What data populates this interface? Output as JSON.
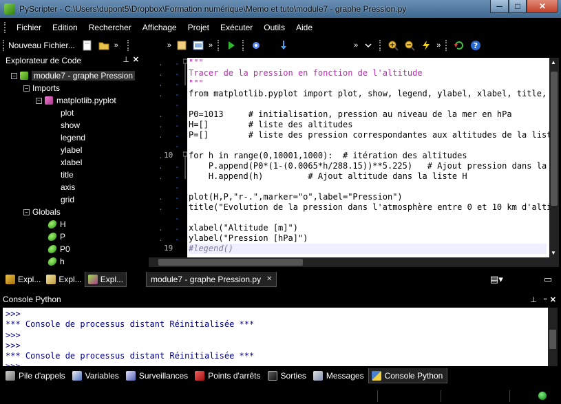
{
  "window": {
    "title": "PyScripter - C:\\Users\\dupont5\\Dropbox\\Formation numérique\\Memo et tuto\\module7 - graphe Pression.py",
    "min_label": "─",
    "max_label": "□",
    "close_label": "✕"
  },
  "menu": [
    "Fichier",
    "Edition",
    "Rechercher",
    "Affichage",
    "Projet",
    "Exécuter",
    "Outils",
    "Aide"
  ],
  "toolbar": {
    "new_file_label": "Nouveau Fichier...",
    "overflow_label": "»"
  },
  "explorer": {
    "title": "Explorateur de Code",
    "module": "module7 - graphe Pression",
    "imports_label": "Imports",
    "import_module": "matplotlib.pyplot",
    "imported_names": [
      "plot",
      "show",
      "legend",
      "ylabel",
      "xlabel",
      "title",
      "axis",
      "grid"
    ],
    "globals_label": "Globals",
    "globals": [
      "H",
      "P",
      "P0",
      "h"
    ],
    "tabs": [
      "Expl...",
      "Expl...",
      "Expl..."
    ]
  },
  "editor": {
    "tab_label": "module7 - graphe Pression.py",
    "tab_close": "✕",
    "line_numbers": [
      "10",
      "19"
    ],
    "code": [
      "\"\"\"",
      "Tracer de la pression en fonction de l'altitude",
      "\"\"\"",
      "from matplotlib.pyplot import plot, show, legend, ylabel, xlabel, title,",
      "",
      "P0=1013     # initialisation, pression au niveau de la mer en hPa",
      "H=[]        # liste des altitudes",
      "P=[]        # liste des pression correspondantes aux altitudes de la list",
      "",
      "for h in range(0,10001,1000):  # itération des altitudes",
      "    P.append(P0*(1-(0.0065*h/288.15))**5.225)   # Ajout pression dans la",
      "    H.append(h)         # Ajout altitude dans la liste H",
      "",
      "plot(H,P,\"r-.\",marker=\"o\",label=\"Pression\")",
      "title(\"Evolution de la pression dans l'atmosphère entre 0 et 10 km d'alti",
      "",
      "xlabel(\"Altitude [m]\")",
      "ylabel(\"Pression [hPa]\")",
      "#legend()"
    ]
  },
  "console": {
    "title": "Console Python",
    "lines": [
      ">>>",
      "*** Console de processus distant Réinitialisée ***",
      ">>>",
      ">>>",
      "*** Console de processus distant Réinitialisée ***",
      ">>>"
    ]
  },
  "bottom_tabs": [
    "Pile d'appels",
    "Variables",
    "Surveillances",
    "Points d'arrêts",
    "Sorties",
    "Messages",
    "Console Python"
  ],
  "icons": {
    "app": "pyscripter-icon",
    "module": "module-icon",
    "import": "import-icon",
    "variable": "variable-icon"
  }
}
